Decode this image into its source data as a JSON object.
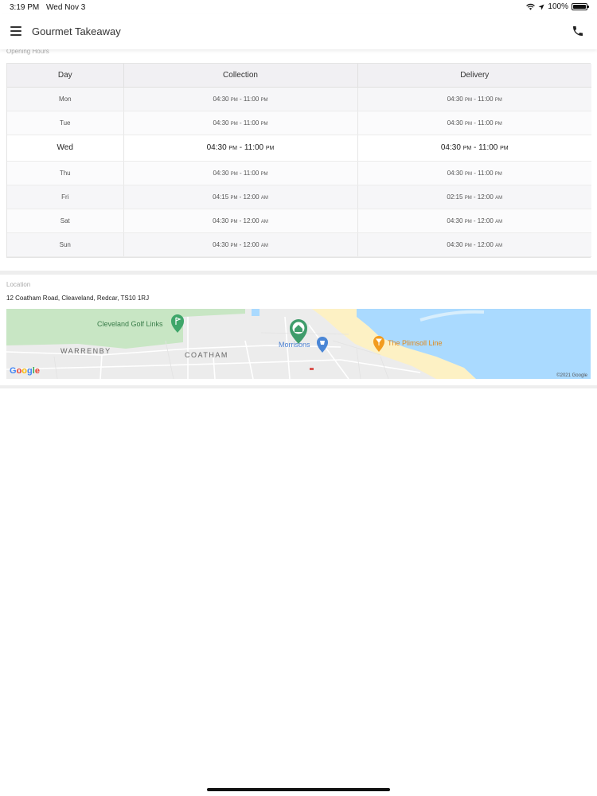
{
  "status": {
    "time": "3:19 PM",
    "date": "Wed Nov 3",
    "battery": "100%"
  },
  "header": {
    "title": "Gourmet Takeaway"
  },
  "opening_hours": {
    "label": "Opening Hours",
    "columns": [
      "Day",
      "Collection",
      "Delivery"
    ],
    "rows": [
      {
        "day": "Mon",
        "c_from": "04:30",
        "c_from_ap": "PM",
        "c_to": "11:00",
        "c_to_ap": "PM",
        "d_from": "04:30",
        "d_from_ap": "PM",
        "d_to": "11:00",
        "d_to_ap": "PM"
      },
      {
        "day": "Tue",
        "c_from": "04:30",
        "c_from_ap": "PM",
        "c_to": "11:00",
        "c_to_ap": "PM",
        "d_from": "04:30",
        "d_from_ap": "PM",
        "d_to": "11:00",
        "d_to_ap": "PM"
      },
      {
        "day": "Wed",
        "c_from": "04:30",
        "c_from_ap": "PM",
        "c_to": "11:00",
        "c_to_ap": "PM",
        "d_from": "04:30",
        "d_from_ap": "PM",
        "d_to": "11:00",
        "d_to_ap": "PM"
      },
      {
        "day": "Thu",
        "c_from": "04:30",
        "c_from_ap": "PM",
        "c_to": "11:00",
        "c_to_ap": "PM",
        "d_from": "04:30",
        "d_from_ap": "PM",
        "d_to": "11:00",
        "d_to_ap": "PM"
      },
      {
        "day": "Fri",
        "c_from": "04:15",
        "c_from_ap": "PM",
        "c_to": "12:00",
        "c_to_ap": "AM",
        "d_from": "02:15",
        "d_from_ap": "PM",
        "d_to": "12:00",
        "d_to_ap": "AM"
      },
      {
        "day": "Sat",
        "c_from": "04:30",
        "c_from_ap": "PM",
        "c_to": "12:00",
        "c_to_ap": "AM",
        "d_from": "04:30",
        "d_from_ap": "PM",
        "d_to": "12:00",
        "d_to_ap": "AM"
      },
      {
        "day": "Sun",
        "c_from": "04:30",
        "c_from_ap": "PM",
        "c_to": "12:00",
        "c_to_ap": "AM",
        "d_from": "04:30",
        "d_from_ap": "PM",
        "d_to": "12:00",
        "d_to_ap": "AM"
      }
    ]
  },
  "location": {
    "label": "Location",
    "address": "12 Coatham Road, Cleaveland, Redcar, TS10 1RJ",
    "map": {
      "labels": {
        "golf": "Cleveland Golf Links",
        "warrenby": "WARRENBY",
        "coatham": "COATHAM",
        "morrisons": "Morrisons",
        "plimsoll": "The Plimsoll Line"
      },
      "copyright": "©2021 Google",
      "logo": "Google"
    }
  },
  "colors": {
    "water": "#aadaff",
    "park": "#c8e6c4",
    "sand": "#fdf1c4",
    "land": "#ececec",
    "pin_green": "#3f9c6b",
    "pin_blue": "#4a86d6",
    "pin_orange": "#f29c1f"
  }
}
